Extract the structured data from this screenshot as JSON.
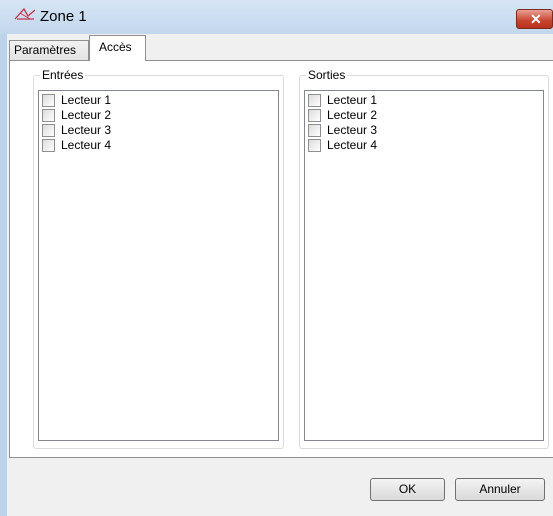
{
  "window": {
    "title": "Zone 1",
    "icon": "zone-icon",
    "close_glyph": "✕"
  },
  "tabs": [
    {
      "label": "Paramètres",
      "selected": false
    },
    {
      "label": "Accès",
      "selected": true
    }
  ],
  "entrees": {
    "label": "Entrées",
    "items": [
      {
        "label": "Lecteur 1",
        "checked": false
      },
      {
        "label": "Lecteur 2",
        "checked": false
      },
      {
        "label": "Lecteur 3",
        "checked": false
      },
      {
        "label": "Lecteur 4",
        "checked": false
      }
    ]
  },
  "sorties": {
    "label": "Sorties",
    "items": [
      {
        "label": "Lecteur 1",
        "checked": false
      },
      {
        "label": "Lecteur 2",
        "checked": false
      },
      {
        "label": "Lecteur 3",
        "checked": false
      },
      {
        "label": "Lecteur 4",
        "checked": false
      }
    ]
  },
  "buttons": {
    "ok": "OK",
    "cancel": "Annuler"
  }
}
